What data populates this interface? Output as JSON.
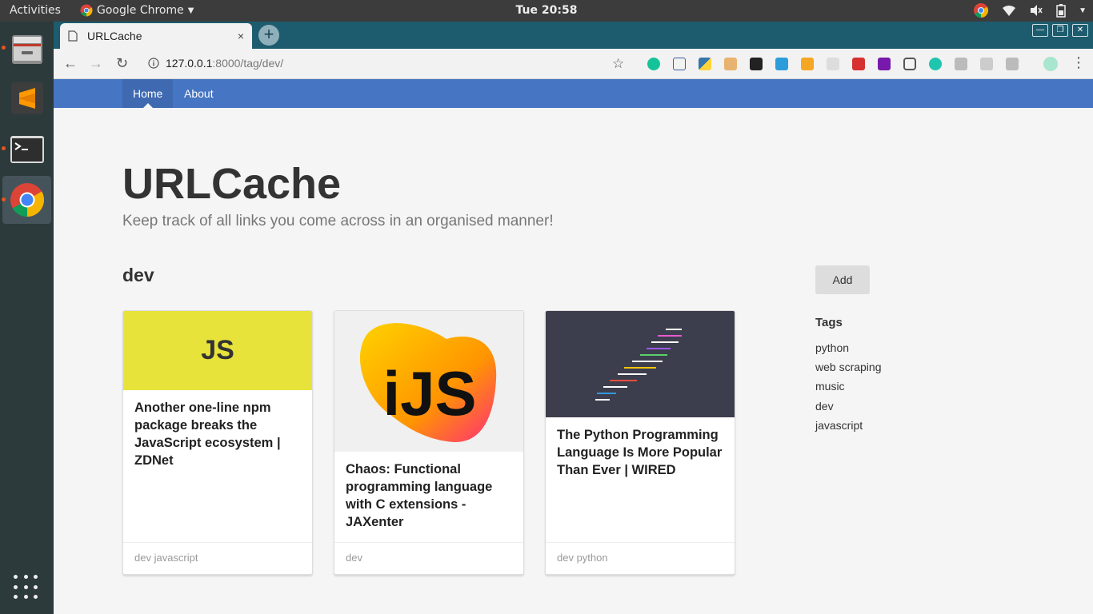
{
  "system": {
    "activities": "Activities",
    "app_name": "Google Chrome",
    "clock": "Tue 20:58"
  },
  "dock": {
    "items": [
      "files",
      "sublime-text",
      "terminal",
      "chrome"
    ],
    "apps_grid": "show-applications"
  },
  "browser": {
    "tab_title": "URLCache",
    "url_host": "127.0.0.1",
    "url_path": ":8000/tag/dev/",
    "new_tab": "+",
    "close_tab": "×"
  },
  "site": {
    "nav": [
      {
        "label": "Home"
      },
      {
        "label": "About"
      }
    ],
    "title": "URLCache",
    "tagline": "Keep track of all links you come across in an organised manner!",
    "current_tag": "dev",
    "add_label": "Add",
    "tags_heading": "Tags",
    "tags": [
      "python",
      "web scraping",
      "music",
      "dev",
      "javascript"
    ],
    "cards": [
      {
        "thumb_label": "JS",
        "title": "Another one-line npm package breaks the JavaScript ecosystem | ZDNet",
        "tags": "dev javascript",
        "thumb_color": "#e8e33a"
      },
      {
        "thumb_label": "iJS",
        "title": "Chaos: Functional programming language with C extensions - JAXenter",
        "tags": "dev",
        "thumb_color": "#f0f0f0"
      },
      {
        "thumb_label": "",
        "title": "The Python Programming Language Is More Popular Than Ever | WIRED",
        "tags": "dev python",
        "thumb_color": "#3c3e4d"
      }
    ]
  },
  "colors": {
    "nav_blue": "#4675c3",
    "tab_bar": "#1d5c6e"
  }
}
